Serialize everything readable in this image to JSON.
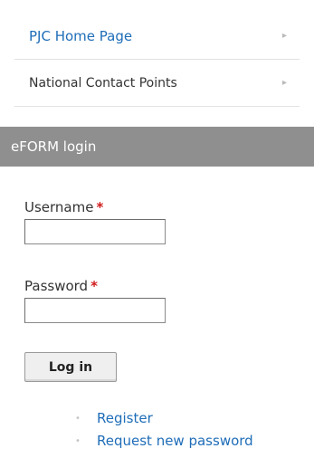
{
  "menu": {
    "items": [
      {
        "label": "PJC Home Page",
        "arrow": "▸"
      },
      {
        "label": "National Contact Points",
        "arrow": "▸"
      }
    ]
  },
  "login_block": {
    "title": "eFORM login",
    "username": {
      "label": "Username",
      "required": "*",
      "value": ""
    },
    "password": {
      "label": "Password",
      "required": "*",
      "value": ""
    },
    "submit_label": "Log in",
    "links": [
      {
        "label": "Register",
        "bullet": "•"
      },
      {
        "label": "Request new password",
        "bullet": "•"
      }
    ]
  },
  "colors": {
    "link": "#1f6db8",
    "header_bg": "#8e8f8e",
    "required": "#d11b1b"
  }
}
